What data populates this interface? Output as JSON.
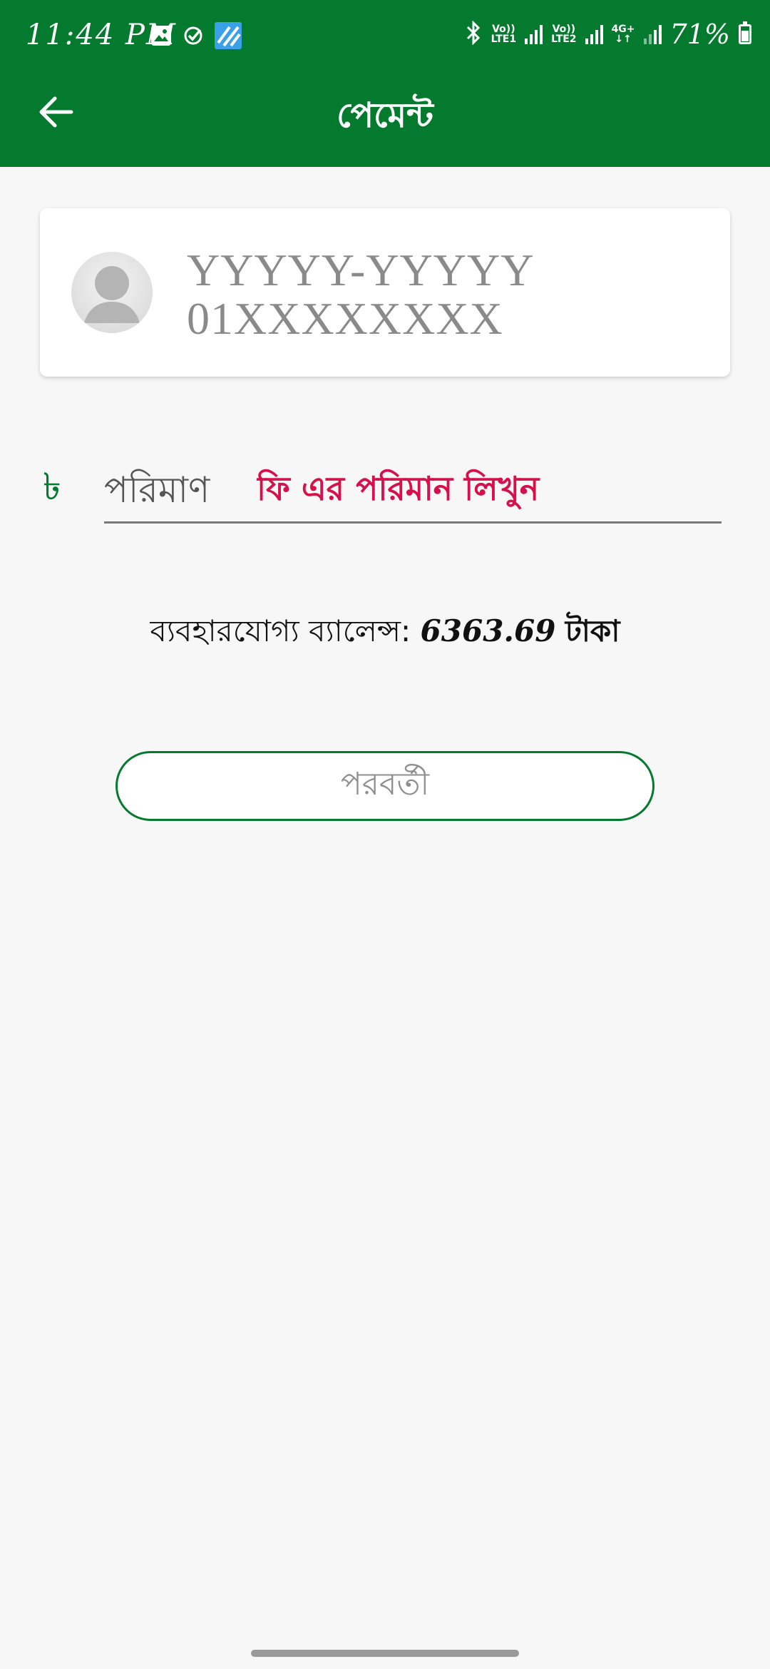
{
  "status_bar": {
    "time": "11:44 PM",
    "sim1_tag_top": "Vo))",
    "sim1_tag_bottom": "LTE1",
    "sim2_tag_top": "Vo))",
    "sim2_tag_bottom": "LTE2",
    "network_type": "4G+",
    "battery_percent": "71%",
    "icons": [
      "image-icon",
      "check-circle-icon",
      "app-notification-icon",
      "bluetooth-icon",
      "signal-icon",
      "battery-icon"
    ]
  },
  "app_bar": {
    "title": "পেমেন্ট",
    "back_icon": "arrow-left-icon"
  },
  "profile": {
    "name": "YYYYY-YYYYY",
    "phone": "01XXXXXXXX",
    "avatar_icon": "person-icon"
  },
  "amount": {
    "currency_symbol": "৳",
    "label": "পরিমাণ",
    "placeholder": "ফি এর পরিমান লিখুন",
    "value": ""
  },
  "balance": {
    "label": "ব্যবহারযোগ্য ব্যালেন্স:",
    "amount": "6363.69",
    "unit": "টাকা"
  },
  "next_button": {
    "label": "পরবর্তী"
  },
  "colors": {
    "primary_green": "#047a2e",
    "placeholder_red": "#d6104a",
    "background": "#f7f7f7"
  }
}
